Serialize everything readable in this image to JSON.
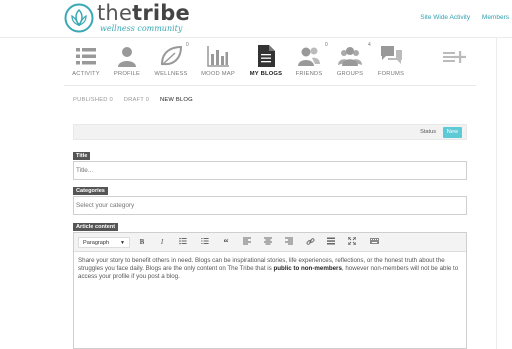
{
  "header": {
    "logo_word_regular": "the",
    "logo_word_bold": "tribe",
    "logo_tagline": "wellness community",
    "links": [
      "Site Wide Activity",
      "Members"
    ]
  },
  "nav": {
    "items": [
      {
        "label": "ACTIVITY",
        "icon": "activity-list-icon"
      },
      {
        "label": "PROFILE",
        "icon": "profile-person-icon"
      },
      {
        "label": "WELLNESS",
        "icon": "leaf-icon",
        "badge": "0"
      },
      {
        "label": "MOOD MAP",
        "icon": "bar-chart-icon"
      },
      {
        "label": "MY BLOGS",
        "icon": "document-icon",
        "active": true
      },
      {
        "label": "FRIENDS",
        "icon": "friends-icon",
        "badge": "0"
      },
      {
        "label": "GROUPS",
        "icon": "groups-icon",
        "badge": "4"
      },
      {
        "label": "FORUMS",
        "icon": "forums-chat-icon"
      }
    ],
    "more_icon": "list-add-icon"
  },
  "subtabs": {
    "published": "PUBLISHED 0",
    "draft": "DRAFT 0",
    "new_blog": "NEW BLOG"
  },
  "status": {
    "label": "Status",
    "value": "New"
  },
  "form": {
    "title_label": "Title",
    "title_placeholder": "Title...",
    "categories_label": "Categories",
    "categories_placeholder": "Select your category",
    "content_label": "Article content"
  },
  "editor": {
    "format_select": "Paragraph",
    "toolbar_icons": [
      "bold-icon",
      "italic-icon",
      "bullet-list-icon",
      "numbered-list-icon",
      "blockquote-icon",
      "align-left-icon",
      "align-center-icon",
      "align-right-icon",
      "link-icon",
      "horizontal-rule-icon",
      "fullscreen-icon",
      "keyboard-icon"
    ],
    "body_part1": "Share your story to benefit others in need. Blogs can be inspirational stories, life experiences, reflections, or the honest truth about the struggles you face daily. Blogs are the only content on The Tribe that is ",
    "body_bold": "public to non-members",
    "body_part2": ", however non-members will not be able to access your profile if you post a blog."
  },
  "colors": {
    "accent": "#3aa9b5",
    "status_badge": "#5ecad6",
    "label_bg": "#555555"
  }
}
